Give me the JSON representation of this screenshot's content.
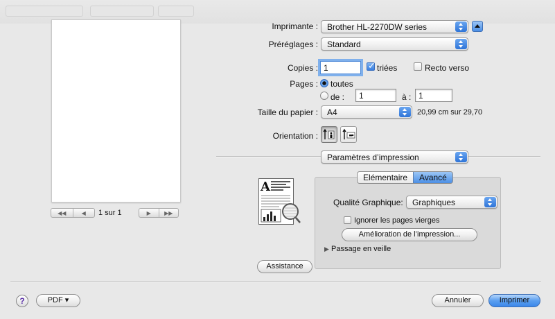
{
  "printer": {
    "label": "Imprimante :",
    "value": "Brother HL-2270DW series"
  },
  "presets": {
    "label": "Préréglages :",
    "value": "Standard"
  },
  "copies": {
    "label": "Copies :",
    "value": "1",
    "collated_label": "triées",
    "collated": true,
    "duplex_label": "Recto verso",
    "duplex": false
  },
  "pages": {
    "label": "Pages :",
    "all_label": "toutes",
    "from_label": "de :",
    "from_value": "1",
    "to_label": "à :",
    "to_value": "1"
  },
  "paper": {
    "label": "Taille du papier :",
    "value": "A4",
    "size_text": "20,99 cm sur 29,70"
  },
  "orientation": {
    "label": "Orientation :"
  },
  "section_popup": {
    "value": "Paramètres d’impression"
  },
  "tabs": [
    {
      "label": "Elémentaire"
    },
    {
      "label": "Avancé"
    }
  ],
  "advanced": {
    "quality_label": "Qualité Graphique:",
    "quality_value": "Graphiques",
    "skip_blank_label": "Ignorer les pages vierges",
    "improve_button": "Amélioration de l’impression...",
    "sleep_label": "Passage en veille"
  },
  "assist_button": "Assistance",
  "preview": {
    "page_count": "1 sur 1"
  },
  "footer": {
    "help": "?",
    "pdf_label": "PDF ▾",
    "cancel_label": "Annuler",
    "print_label": "Imprimer"
  },
  "colors": {
    "accent": "#3b87ea",
    "background": "#e8e8e8"
  }
}
